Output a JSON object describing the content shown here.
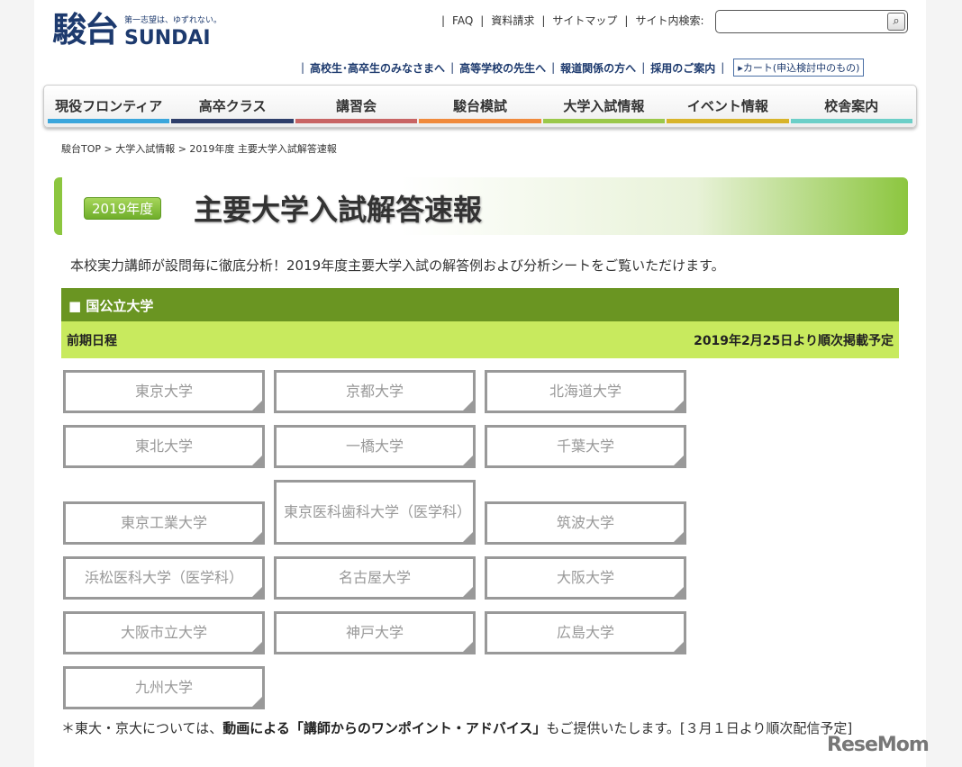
{
  "logo": {
    "kanji": "駿台",
    "tagline": "第一志望は、ゆずれない。",
    "en": "SUNDAI"
  },
  "top_links": [
    "FAQ",
    "資料請求",
    "サイトマップ"
  ],
  "search": {
    "label": "サイト内検索:",
    "value": "",
    "placeholder": "",
    "icon": "search-icon"
  },
  "sub_links": [
    "高校生･高卒生のみなさまへ",
    "高等学校の先生へ",
    "報道関係の方へ",
    "採用のご案内"
  ],
  "cart": "▸カート(申込検討中のもの)",
  "nav": [
    {
      "label": "現役フロンティア",
      "color": "#3ba6dc"
    },
    {
      "label": "高卒クラス",
      "color": "#2f3f6b"
    },
    {
      "label": "講習会",
      "color": "#c86464"
    },
    {
      "label": "駿台模試",
      "color": "#f08a3c"
    },
    {
      "label": "大学入試情報",
      "color": "#9bc84a"
    },
    {
      "label": "イベント情報",
      "color": "#d8b42a"
    },
    {
      "label": "校舎案内",
      "color": "#6ccfc8"
    }
  ],
  "breadcrumb": "駿台TOP > 大学入試情報 > 2019年度  主要大学入試解答速報",
  "banner": {
    "year": "2019年度",
    "title": "主要大学入試解答速報"
  },
  "intro": "本校実力講師が設問毎に徹底分析！2019年度主要大学入試の解答例および分析シートをご覧いただけます。",
  "section": {
    "title": "■ 国公立大学",
    "schedule": "前期日程",
    "schedule_note": "2019年2月25日より順次掲載予定"
  },
  "universities": [
    "東京大学",
    "京都大学",
    "北海道大学",
    "東北大学",
    "一橋大学",
    "千葉大学",
    "東京工業大学",
    "東京医科歯科大学（医学科）",
    "筑波大学",
    "浜松医科大学（医学科）",
    "名古屋大学",
    "大阪大学",
    "大阪市立大学",
    "神戸大学",
    "広島大学",
    "九州大学"
  ],
  "note": {
    "prefix": "＊東大・京大については、",
    "bold": "動画による「講師からのワンポイント・アドバイス」",
    "suffix": "もご提供いたします。[３月１日より順次配信予定]"
  },
  "watermark": "ReseMom"
}
